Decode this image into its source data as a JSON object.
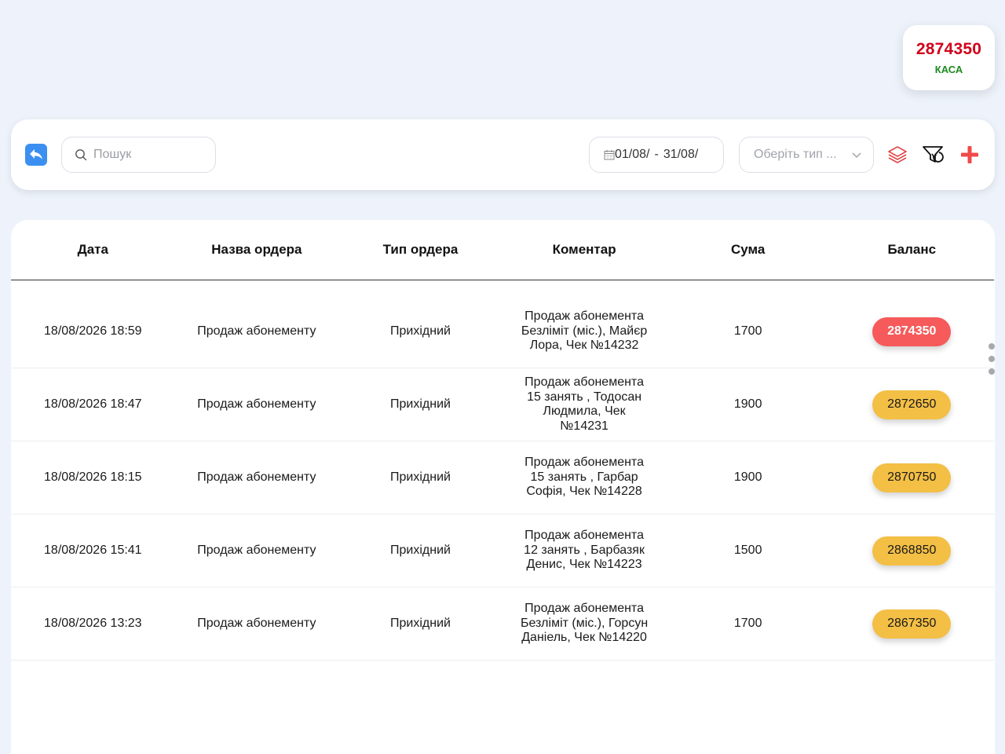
{
  "kasa": {
    "value": "2874350",
    "label": "КАСА"
  },
  "toolbar": {
    "search_placeholder": "Пошук",
    "date_from": "01/08/",
    "date_separator": "-",
    "date_to": "31/08/",
    "type_placeholder": "Оберіть тип ...",
    "icons": [
      "back-arrow-icon",
      "search-icon",
      "calendar-icon",
      "chevron-down-icon",
      "layers-icon",
      "reset-filter-icon",
      "plus-icon"
    ]
  },
  "colors": {
    "accent_blue": "#3b8ff0",
    "red": "#f65a5a",
    "yellow": "#f3bf45",
    "kasa_red": "#d0021b",
    "kasa_green": "#1e8a1e"
  },
  "table": {
    "headers": [
      "Дата",
      "Назва ордера",
      "Тип ордера",
      "Коментар",
      "Сума",
      "Баланс"
    ],
    "rows": [
      {
        "date": "18/08/2026 18:59",
        "name": "Продаж абонементу",
        "type": "Прихідний",
        "comment": "Продаж абонемента Безліміт (міс.), Майєр Лора, Чек №14232",
        "sum": "1700",
        "balance": "2874350",
        "badge": "red"
      },
      {
        "date": "18/08/2026 18:47",
        "name": "Продаж абонементу",
        "type": "Прихідний",
        "comment": "Продаж абонемента 15 занять , Тодосан Людмила, Чек №14231",
        "sum": "1900",
        "balance": "2872650",
        "badge": "yellow"
      },
      {
        "date": "18/08/2026 18:15",
        "name": "Продаж абонементу",
        "type": "Прихідний",
        "comment": "Продаж абонемента 15 занять , Гарбар Софія, Чек №14228",
        "sum": "1900",
        "balance": "2870750",
        "badge": "yellow"
      },
      {
        "date": "18/08/2026 15:41",
        "name": "Продаж абонементу",
        "type": "Прихідний",
        "comment": "Продаж абонемента 12 занять , Барбазяк Денис, Чек №14223",
        "sum": "1500",
        "balance": "2868850",
        "badge": "yellow"
      },
      {
        "date": "18/08/2026 13:23",
        "name": "Продаж абонементу",
        "type": "Прихідний",
        "comment": "Продаж абонемента Безліміт (міс.), Горсун Даніель, Чек №14220",
        "sum": "1700",
        "balance": "2867350",
        "badge": "yellow"
      }
    ]
  }
}
